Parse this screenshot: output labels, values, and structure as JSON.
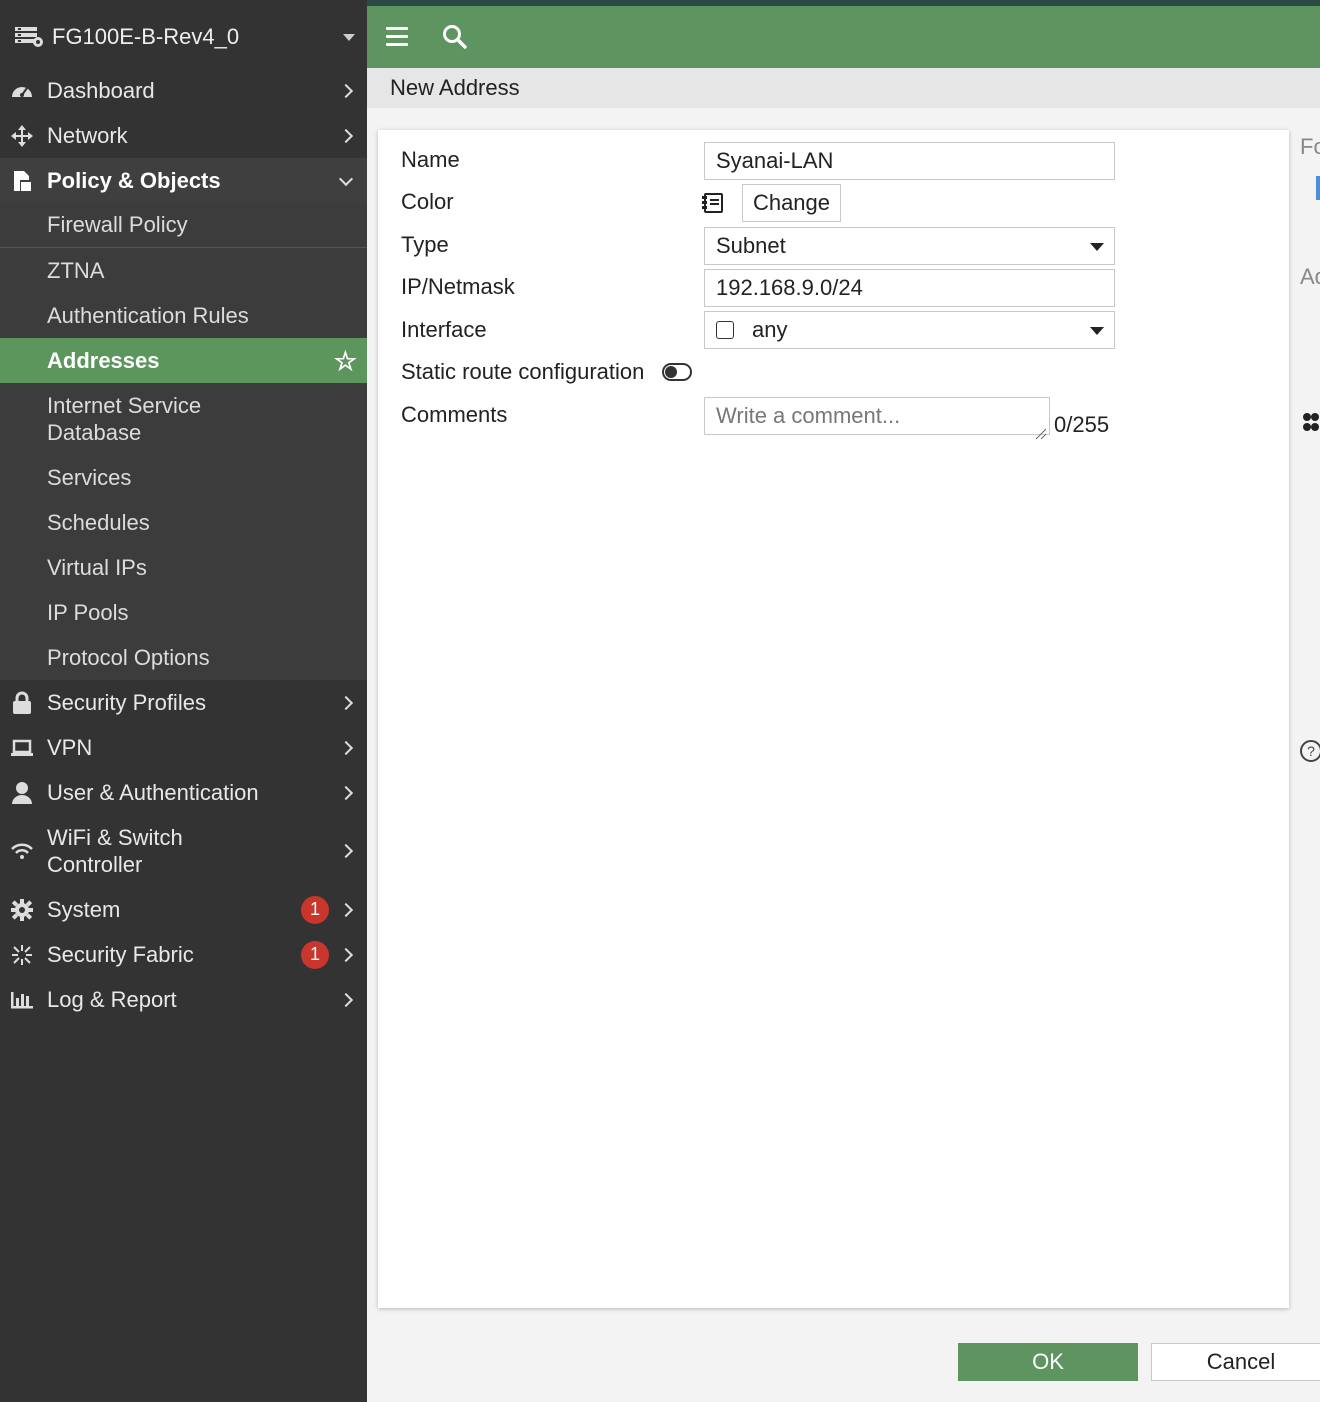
{
  "device": {
    "name": "FG100E-B-Rev4_0"
  },
  "nav": {
    "dashboard": "Dashboard",
    "network": "Network",
    "policy_objects": "Policy & Objects",
    "sub": {
      "firewall_policy": "Firewall Policy",
      "ztna": "ZTNA",
      "auth_rules": "Authentication Rules",
      "addresses": "Addresses",
      "isdb_line1": "Internet Service",
      "isdb_line2": "Database",
      "services": "Services",
      "schedules": "Schedules",
      "virtual_ips": "Virtual IPs",
      "ip_pools": "IP Pools",
      "protocol_options": "Protocol Options"
    },
    "security_profiles": "Security Profiles",
    "vpn": "VPN",
    "user_auth": "User & Authentication",
    "wifi_line1": "WiFi & Switch",
    "wifi_line2": "Controller",
    "system": "System",
    "system_badge": "1",
    "security_fabric": "Security Fabric",
    "security_fabric_badge": "1",
    "log_report": "Log & Report"
  },
  "page": {
    "title": "New Address"
  },
  "form": {
    "name_label": "Name",
    "name_value": "Syanai-LAN",
    "color_label": "Color",
    "change_button": "Change",
    "type_label": "Type",
    "type_value": "Subnet",
    "ip_label": "IP/Netmask",
    "ip_value": "192.168.9.0/24",
    "interface_label": "Interface",
    "interface_value": "any",
    "static_route_label": "Static route configuration",
    "static_route_enabled": false,
    "comments_label": "Comments",
    "comments_placeholder": "Write a comment...",
    "comments_counter": "0/255"
  },
  "right_panel": {
    "text1": "Fo",
    "text2": "Ad"
  },
  "buttons": {
    "ok": "OK",
    "cancel": "Cancel"
  },
  "colors": {
    "accent": "#5e9460",
    "sidebar": "#333333",
    "badge": "#c9372c"
  }
}
